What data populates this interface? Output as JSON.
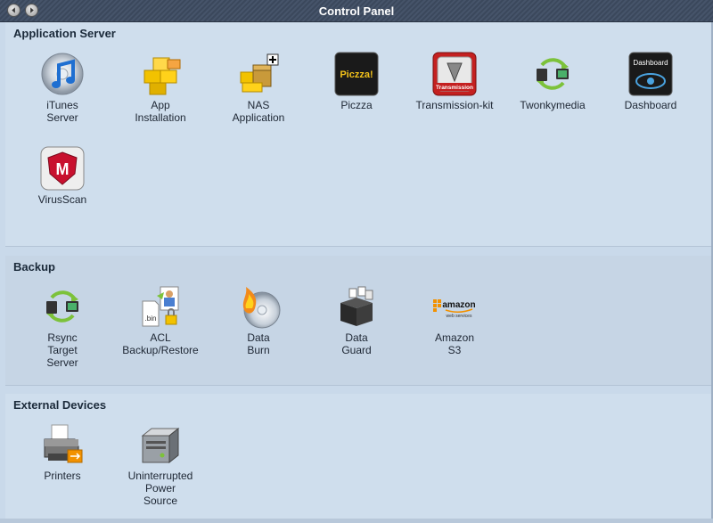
{
  "window": {
    "title": "Control Panel"
  },
  "sections": {
    "application_server": {
      "title": "Application Server",
      "items": [
        {
          "label": "iTunes\nServer",
          "icon": "itunes-icon"
        },
        {
          "label": "App\nInstallation",
          "icon": "blocks-icon"
        },
        {
          "label": "NAS\nApplication",
          "icon": "package-add-icon"
        },
        {
          "label": "Piczza",
          "icon": "piczza-icon",
          "badge": "Piczza!"
        },
        {
          "label": "Transmission-kit",
          "icon": "transmission-icon",
          "badge": "Transmission"
        },
        {
          "label": "Twonkymedia",
          "icon": "sync-devices-icon"
        },
        {
          "label": "Dashboard",
          "icon": "dashboard-icon",
          "badge": "Dashboard"
        },
        {
          "label": "VirusScan",
          "icon": "mcafee-shield-icon",
          "badge": "M"
        }
      ]
    },
    "backup": {
      "title": "Backup",
      "items": [
        {
          "label": "Rsync\nTarget\nServer",
          "icon": "rsync-icon"
        },
        {
          "label": "ACL\nBackup/Restore",
          "icon": "acl-icon",
          "badge": ".bin"
        },
        {
          "label": "Data\nBurn",
          "icon": "disc-burn-icon"
        },
        {
          "label": "Data\nGuard",
          "icon": "data-guard-icon"
        },
        {
          "label": "Amazon\nS3",
          "icon": "amazon-icon",
          "badge": "amazon",
          "badge2": "web services"
        }
      ]
    },
    "external_devices": {
      "title": "External Devices",
      "items": [
        {
          "label": "Printers",
          "icon": "printer-icon"
        },
        {
          "label": "Uninterrupted\nPower\nSource",
          "icon": "ups-icon"
        }
      ]
    }
  },
  "colors": {
    "titlebar": "#46546a",
    "section_bg": "#cfdeed",
    "section_alt_bg": "#c6d5e5",
    "text": "#1d2633"
  }
}
